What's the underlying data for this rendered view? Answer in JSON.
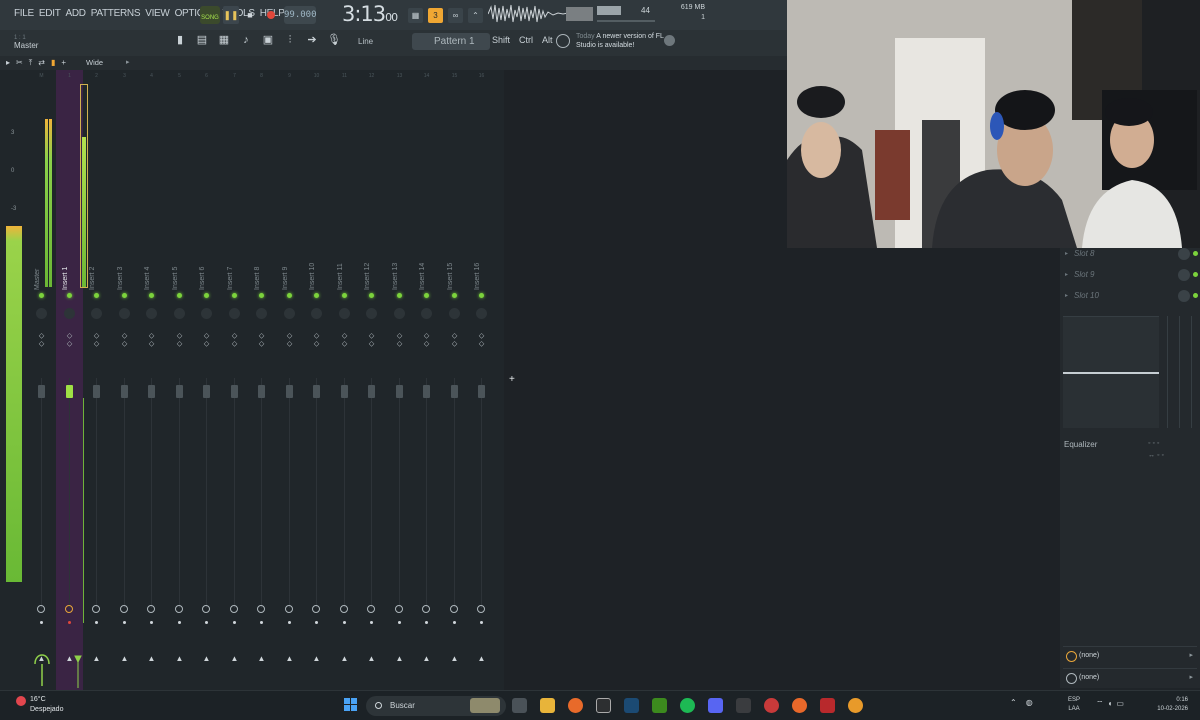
{
  "menu": [
    "FILE",
    "EDIT",
    "ADD",
    "PATTERNS",
    "VIEW",
    "OPTIONS",
    "TOOLS",
    "HELP"
  ],
  "transport": {
    "mode": "SONG",
    "tempo": "99.000",
    "time": "3:13",
    "time_sub": "00"
  },
  "system": {
    "cpu": "44",
    "memory": "619 MB",
    "polyphony": "1"
  },
  "toolbar": {
    "hint": "1 : 1",
    "master_label": "Master",
    "snap_mode": "Line",
    "pattern": "Pattern 1",
    "modifiers": [
      "Shift",
      "Ctrl",
      "Alt"
    ],
    "news_today": "Today",
    "news_text": "A newer version of FL Studio is available!"
  },
  "mixer": {
    "mode": "Wide",
    "scale": [
      "3",
      "0",
      "-3"
    ],
    "tracks": [
      {
        "num": "M",
        "label": "Master"
      },
      {
        "num": "1",
        "label": "Insert 1"
      },
      {
        "num": "2",
        "label": "Insert 2"
      },
      {
        "num": "3",
        "label": "Insert 3"
      },
      {
        "num": "4",
        "label": "Insert 4"
      },
      {
        "num": "5",
        "label": "Insert 5"
      },
      {
        "num": "6",
        "label": "Insert 6"
      },
      {
        "num": "7",
        "label": "Insert 7"
      },
      {
        "num": "8",
        "label": "Insert 8"
      },
      {
        "num": "9",
        "label": "Insert 9"
      },
      {
        "num": "10",
        "label": "Insert 10"
      },
      {
        "num": "11",
        "label": "Insert 11"
      },
      {
        "num": "12",
        "label": "Insert 12"
      },
      {
        "num": "13",
        "label": "Insert 13"
      },
      {
        "num": "14",
        "label": "Insert 14"
      },
      {
        "num": "15",
        "label": "Insert 15"
      },
      {
        "num": "16",
        "label": "Insert 16"
      }
    ]
  },
  "fx_panel": {
    "slots": [
      "Slot 8",
      "Slot 9",
      "Slot 10"
    ],
    "eq_label": "Equalizer",
    "route_in": "(none)",
    "route_out": "(none)"
  },
  "taskbar": {
    "temperature": "16°C",
    "weather": "Despejado",
    "search": "Buscar",
    "lang1": "ESP",
    "lang2": "LAA",
    "time": "0:16",
    "date": "10-02-2026"
  },
  "colors": {
    "accent_green": "#7cd33c",
    "accent_orange": "#f0a733",
    "selected_strip": "#3a2444",
    "record_red": "#e0473b"
  }
}
